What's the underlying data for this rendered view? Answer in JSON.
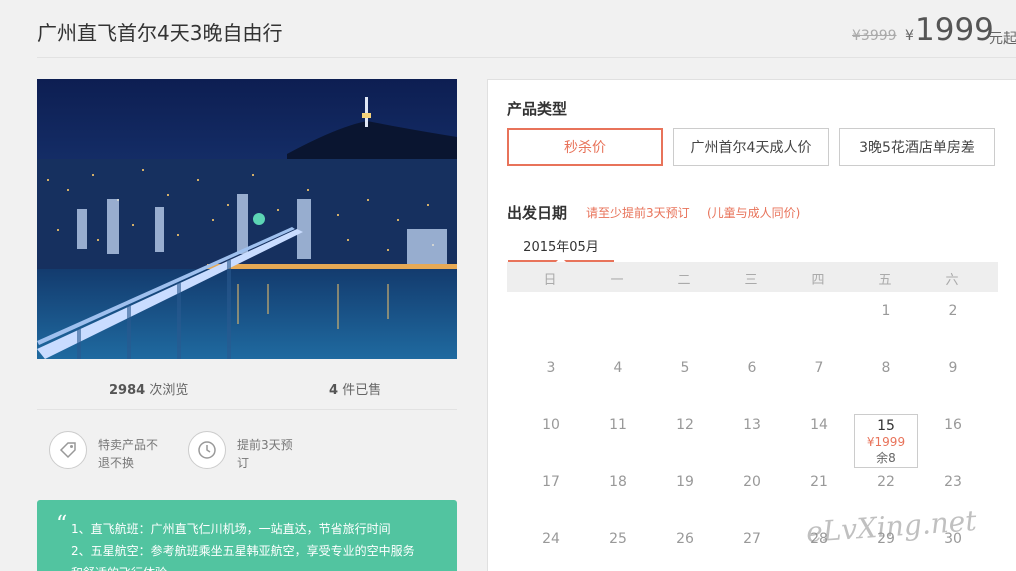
{
  "header": {
    "title": "广州直飞首尔4天3晚自由行",
    "price_old": "¥3999",
    "currency": "¥",
    "price": "1999",
    "price_suffix": "元起"
  },
  "stats": {
    "views_count": "2984",
    "views_label": "次浏览",
    "sold_count": "4",
    "sold_label": "件已售"
  },
  "features": [
    {
      "icon": "tag-icon",
      "text": "特卖产品不退不换"
    },
    {
      "icon": "clock-icon",
      "text": "提前3天预订"
    }
  ],
  "notice": {
    "lines": [
      "1、直飞航班：广州直飞仁川机场，一站直达，节省旅行时间",
      "2、五星航空：参考航班乘坐五星韩亚航空，享受专业的空中服务",
      "和舒适的飞行体验"
    ]
  },
  "product_type": {
    "label": "产品类型",
    "options": [
      "秒杀价",
      "广州首尔4天成人价",
      "3晚5花酒店单房差"
    ],
    "selected": 0
  },
  "departure": {
    "label": "出发日期",
    "hint1": "请至少提前3天预订",
    "hint2": "(儿童与成人同价)",
    "month": "2015年05月",
    "weekdays": [
      "日",
      "一",
      "二",
      "三",
      "四",
      "五",
      "六"
    ],
    "selected_day": {
      "day": "15",
      "price": "¥1999",
      "remain": "余8"
    },
    "days": [
      "1",
      "2",
      "3",
      "4",
      "5",
      "6",
      "7",
      "8",
      "9",
      "10",
      "11",
      "12",
      "13",
      "14",
      "15",
      "16",
      "17",
      "18",
      "19",
      "20",
      "21",
      "22",
      "23",
      "24",
      "25",
      "26",
      "27",
      "28",
      "29",
      "30"
    ]
  },
  "watermark": "eLvXing.net",
  "colors": {
    "accent": "#e8735a",
    "notice_bg": "#52c4a0"
  }
}
